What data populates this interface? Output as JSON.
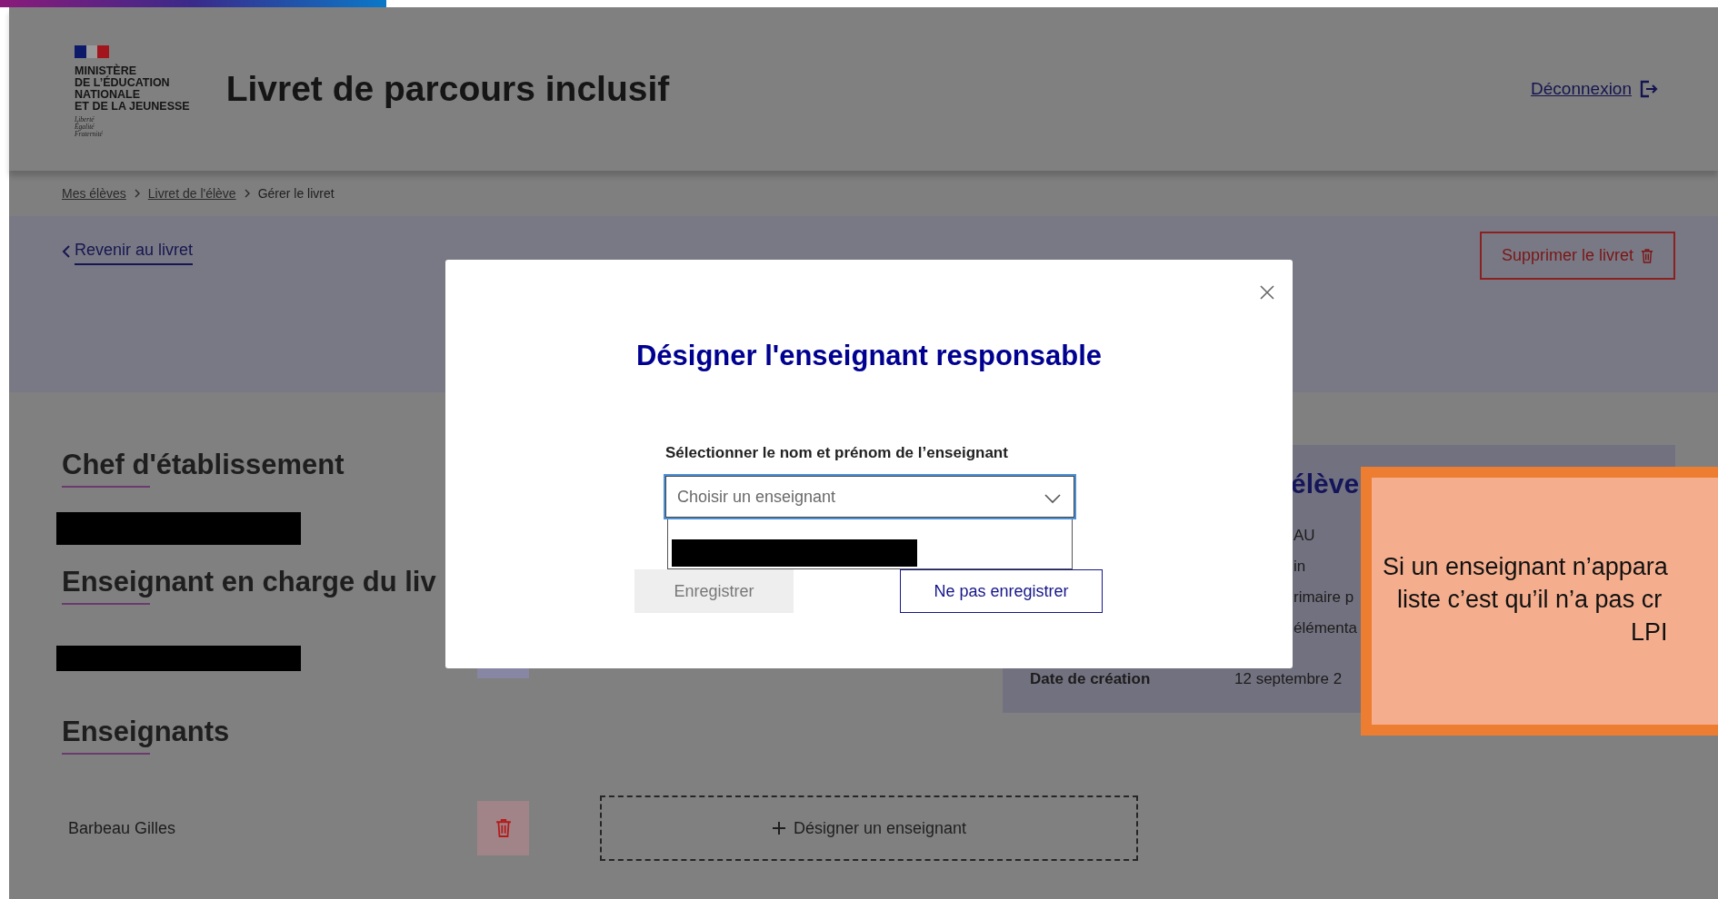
{
  "header": {
    "logo": {
      "ministry_lines": [
        "MINISTÈRE",
        "DE L’ÉDUCATION",
        "NATIONALE",
        "ET DE LA JEUNESSE"
      ],
      "motto_lines": [
        "Liberté",
        "Égalité",
        "Fraternité"
      ]
    },
    "title": "Livret de parcours inclusif",
    "logout": "Déconnexion"
  },
  "breadcrumb": [
    {
      "label": "Mes élèves",
      "link": true
    },
    {
      "label": "Livret de l'élève",
      "link": true
    },
    {
      "label": "Gérer le livret",
      "link": false
    }
  ],
  "back_link": "Revenir au livret",
  "delete_button": "Supprimer le livret",
  "sections": [
    {
      "title": "Chef d'établissement",
      "redacted": true
    },
    {
      "title": "Enseignant en charge du liv",
      "redacted": true
    },
    {
      "title": "Enseignants",
      "redacted": false
    }
  ],
  "teachers": [
    {
      "name": "Barbeau Gilles"
    }
  ],
  "add_teacher": "Désigner un enseignant",
  "student_panel": {
    "title": "élève",
    "rows": [
      {
        "kind": "partial",
        "value": "AU"
      },
      {
        "kind": "partial",
        "value": "in"
      },
      {
        "kind": "partial",
        "value": "rimaire p"
      },
      {
        "kind": "partial",
        "value": "élémenta"
      },
      {
        "kind": "full",
        "label": "Date de création",
        "value": "12 septembre 2"
      }
    ]
  },
  "modal": {
    "title": "Désigner l'enseignant responsable",
    "field_label": "Sélectionner le nom et prénom de l’enseignant",
    "placeholder": "Choisir un enseignant",
    "dropdown_open": true,
    "buttons": [
      {
        "label": "Enregistrer",
        "disabled": true
      },
      {
        "label": "Ne pas enregistrer",
        "disabled": false
      }
    ]
  },
  "callout": {
    "lines": [
      "Si un enseignant n’appara",
      "liste c’est qu’il n’a pas cr",
      "LPI"
    ]
  }
}
